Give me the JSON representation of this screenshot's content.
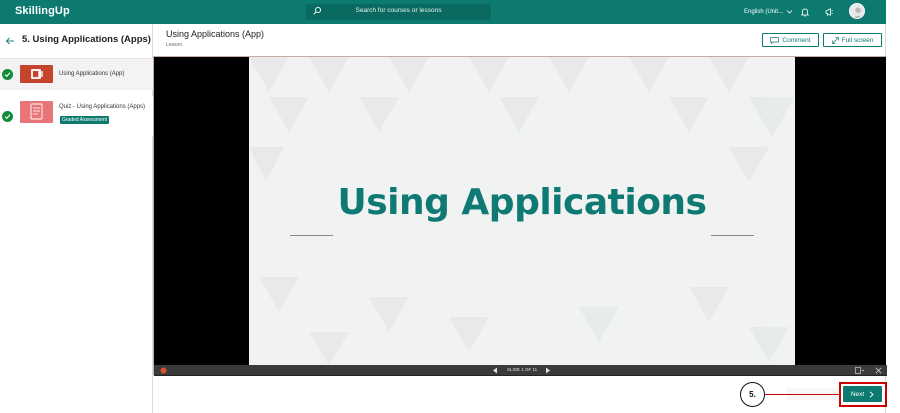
{
  "app": {
    "brand": "SkillingUp"
  },
  "header": {
    "search_placeholder": "Search for courses or lessons",
    "language": "English (Unit..."
  },
  "sidebar": {
    "module_title": "5. Using Applications (Apps)",
    "items": [
      {
        "label": "Using Applications (App)",
        "completed": true
      },
      {
        "label": "Quiz - Using Applications (Apps)",
        "badge": "Graded Assessment",
        "completed": true
      }
    ]
  },
  "lesson": {
    "title": "Using Applications (App)",
    "type": "Lesson",
    "comment_label": "Comment",
    "fullscreen_label": "Full screen"
  },
  "slide": {
    "title": "Using Applications",
    "counter": "SLIDE 1 OF 11"
  },
  "footer": {
    "next_label": "Next",
    "callout": "5."
  },
  "colors": {
    "brand": "#0d7a6f",
    "slide_title": "#0f7a73",
    "callout": "#cc0000",
    "check": "#128a3a"
  }
}
